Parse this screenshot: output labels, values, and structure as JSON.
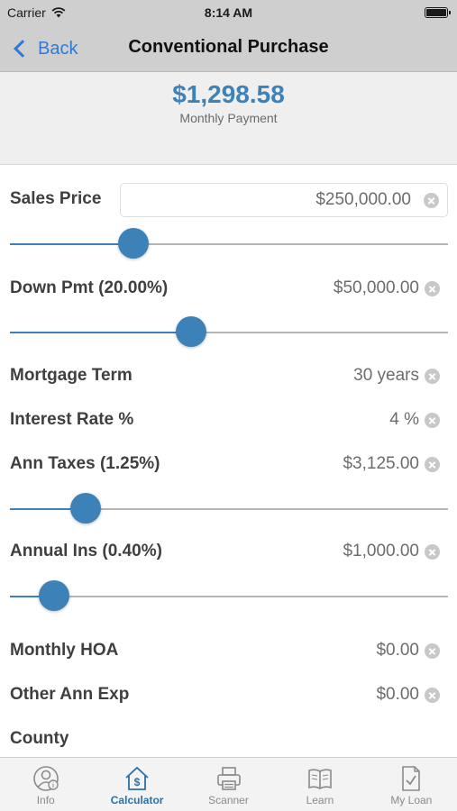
{
  "status_bar": {
    "carrier": "Carrier",
    "time": "8:14 AM"
  },
  "nav": {
    "back_label": "Back",
    "title": "Conventional Purchase"
  },
  "summary": {
    "amount": "$1,298.58",
    "label": "Monthly Payment"
  },
  "fields": {
    "sales_price": {
      "label": "Sales Price",
      "value": "$250,000.00"
    },
    "down_payment": {
      "label": "Down Pmt (20.00%)",
      "value": "$50,000.00"
    },
    "mortgage_term": {
      "label": "Mortgage Term",
      "value": "30 years"
    },
    "interest_rate": {
      "label": "Interest Rate %",
      "value": "4 %"
    },
    "ann_taxes": {
      "label": "Ann Taxes (1.25%)",
      "value": "$3,125.00"
    },
    "annual_ins": {
      "label": "Annual Ins (0.40%)",
      "value": "$1,000.00"
    },
    "monthly_hoa": {
      "label": "Monthly HOA",
      "value": "$0.00"
    },
    "other_ann_exp": {
      "label": "Other Ann Exp",
      "value": "$0.00"
    },
    "county": {
      "label": "County"
    }
  },
  "sliders": {
    "sales_price": 0.282,
    "down_payment": 0.413,
    "ann_taxes": 0.173,
    "annual_ins": 0.1
  },
  "tabs": [
    {
      "label": "Info",
      "icon": "info-person-icon",
      "active": false
    },
    {
      "label": "Calculator",
      "icon": "calculator-house-icon",
      "active": true
    },
    {
      "label": "Scanner",
      "icon": "printer-icon",
      "active": false
    },
    {
      "label": "Learn",
      "icon": "open-book-icon",
      "active": false
    },
    {
      "label": "My Loan",
      "icon": "document-check-icon",
      "active": false
    }
  ],
  "colors": {
    "accent": "#3c82b8",
    "link": "#2f7ad9",
    "active_tab": "#2d6fa6"
  }
}
